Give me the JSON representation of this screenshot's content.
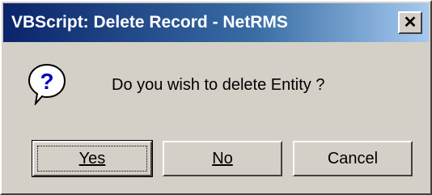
{
  "window": {
    "title": "VBScript: Delete Record - NetRMS",
    "close_icon": "close-icon"
  },
  "dialog": {
    "icon": "question-icon",
    "message": "Do you wish to delete Entity ?"
  },
  "buttons": {
    "yes_label": "Yes",
    "no_label": "No",
    "cancel_label": "Cancel"
  },
  "colors": {
    "title_bar_start": "#0a246a",
    "title_bar_end": "#a6caf0",
    "dialog_face": "#d4d0c8",
    "icon_bubble": "#ffffff",
    "icon_glyph": "#0000c0"
  }
}
